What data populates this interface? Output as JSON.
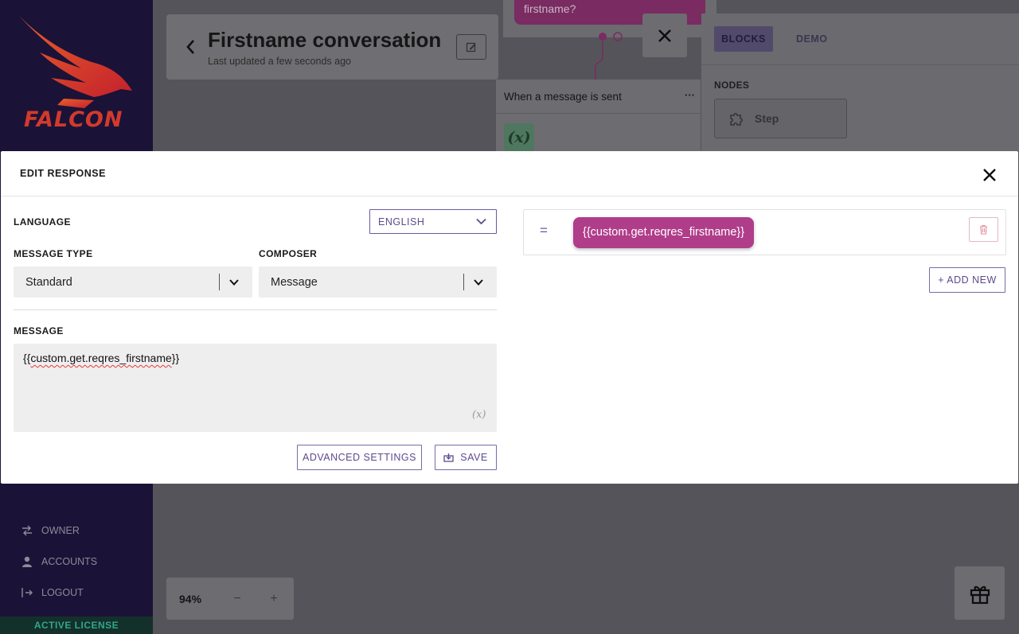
{
  "sidebar": {
    "brand": "FALCON",
    "items": [
      {
        "label": "OWNER",
        "icon": "swap-icon"
      },
      {
        "label": "ACCOUNTS",
        "icon": "user-icon"
      },
      {
        "label": "LOGOUT",
        "icon": "logout-icon"
      }
    ],
    "license": "ACTIVE LICENSE"
  },
  "canvas": {
    "title": "Firstname conversation",
    "subtitle": "Last updated a few seconds ago",
    "bubble_text": "firstname?",
    "trigger_label": "When a message is sent",
    "trigger_menu": "···",
    "variable_glyph": "(x)",
    "zoom": {
      "value": "94%",
      "minus": "−",
      "plus": "+"
    }
  },
  "panel": {
    "tabs": [
      "BLOCKS",
      "DEMO"
    ],
    "nodes_label": "NODES",
    "step_label": "Step"
  },
  "modal": {
    "title": "EDIT RESPONSE",
    "language_label": "LANGUAGE",
    "language_value": "ENGLISH",
    "message_type_label": "MESSAGE TYPE",
    "message_type_value": "Standard",
    "composer_label": "COMPOSER",
    "composer_value": "Message",
    "message_label": "MESSAGE",
    "message_prefix": "{{",
    "message_body": "custom.get.reqres_firstname",
    "message_suffix": "}}",
    "variable_hint": "(x)",
    "advanced_button": "ADVANCED SETTINGS",
    "save_button": "SAVE",
    "handle_glyph": "=",
    "response_pill": "{{custom.get.reqres_firstname}}",
    "add_new_button": "+ ADD NEW"
  },
  "colors": {
    "accent": "#5d4a8e",
    "pill": "#b03d8a",
    "sidebar": "#1b1237",
    "license": "#2fa88a"
  }
}
